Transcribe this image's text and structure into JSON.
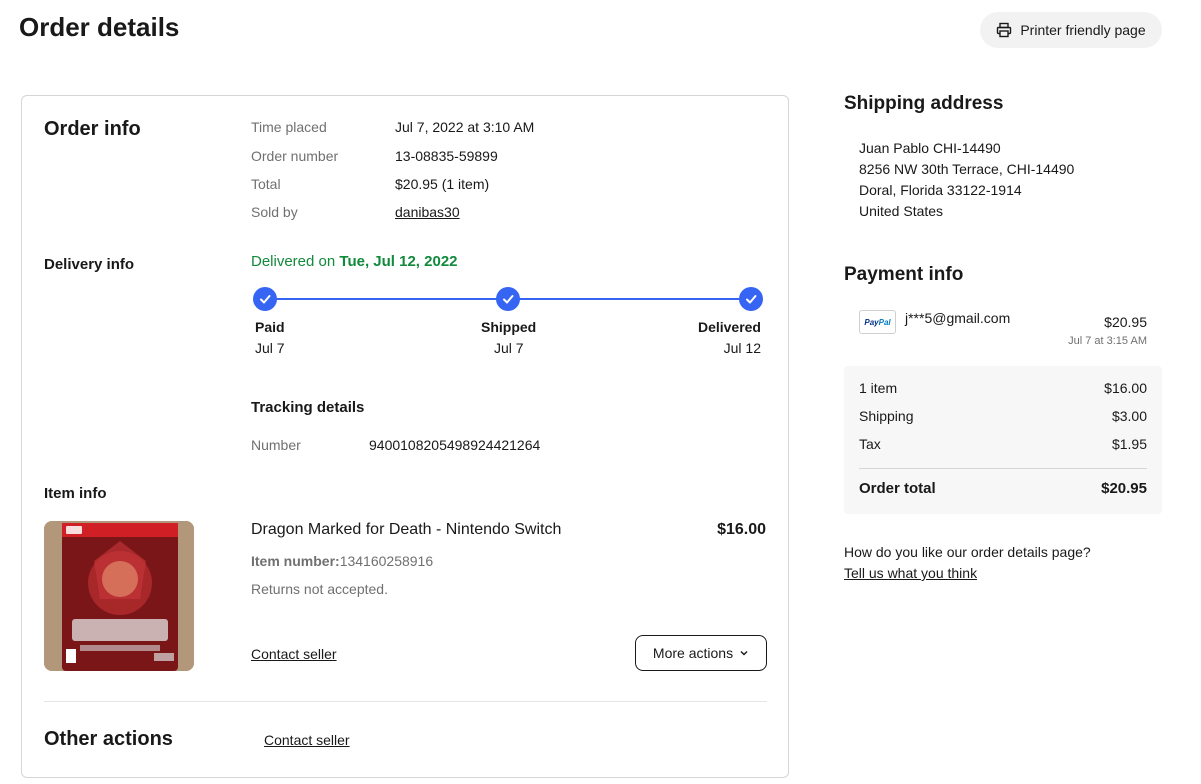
{
  "page": {
    "title": "Order details",
    "printer_label": "Printer friendly page"
  },
  "order_info": {
    "title": "Order info",
    "time_placed_label": "Time placed",
    "time_placed": "Jul 7, 2022 at 3:10 AM",
    "order_number_label": "Order number",
    "order_number": "13-08835-59899",
    "total_label": "Total",
    "total": "$20.95 (1 item)",
    "sold_by_label": "Sold by",
    "sold_by": "danibas30"
  },
  "delivery_info": {
    "title": "Delivery info",
    "delivered_prefix": "Delivered on ",
    "delivered_date": "Tue, Jul 12, 2022",
    "steps": [
      {
        "name": "Paid",
        "date": "Jul 7"
      },
      {
        "name": "Shipped",
        "date": "Jul 7"
      },
      {
        "name": "Delivered",
        "date": "Jul 12"
      }
    ],
    "progress": 1.0,
    "tracking_title": "Tracking details",
    "tracking_number_label": "Number",
    "tracking_number": "9400108205498924421264"
  },
  "item_info": {
    "title": "Item info",
    "item_title": "Dragon Marked for Death - Nintendo Switch",
    "price": "$16.00",
    "item_number_label": "Item number:",
    "item_number": "134160258916",
    "returns": "Returns not accepted.",
    "contact_seller": "Contact seller",
    "more_actions": "More actions"
  },
  "other_actions": {
    "title": "Other actions",
    "contact_seller": "Contact seller"
  },
  "shipping_address": {
    "title": "Shipping address",
    "lines": [
      "Juan Pablo CHI-14490",
      "8256 NW 30th Terrace, CHI-14490",
      "Doral, Florida 33122-1914",
      "United States"
    ]
  },
  "payment_info": {
    "title": "Payment info",
    "method_logo": "PayPal",
    "email": "j***5@gmail.com",
    "amount": "$20.95",
    "paid_time": "Jul 7 at 3:15 AM"
  },
  "summary": {
    "rows": [
      {
        "label": "1 item",
        "value": "$16.00"
      },
      {
        "label": "Shipping",
        "value": "$3.00"
      },
      {
        "label": "Tax",
        "value": "$1.95"
      }
    ],
    "total_label": "Order total",
    "total_value": "$20.95"
  },
  "feedback": {
    "question": "How do you like our order details page?",
    "link": "Tell us what you think"
  },
  "colors": {
    "accent": "#3665f3",
    "delivered_green": "#118a3c",
    "muted": "#707070"
  },
  "icons": [
    "printer-icon",
    "check-icon",
    "chevron-down-icon",
    "paypal-logo"
  ]
}
